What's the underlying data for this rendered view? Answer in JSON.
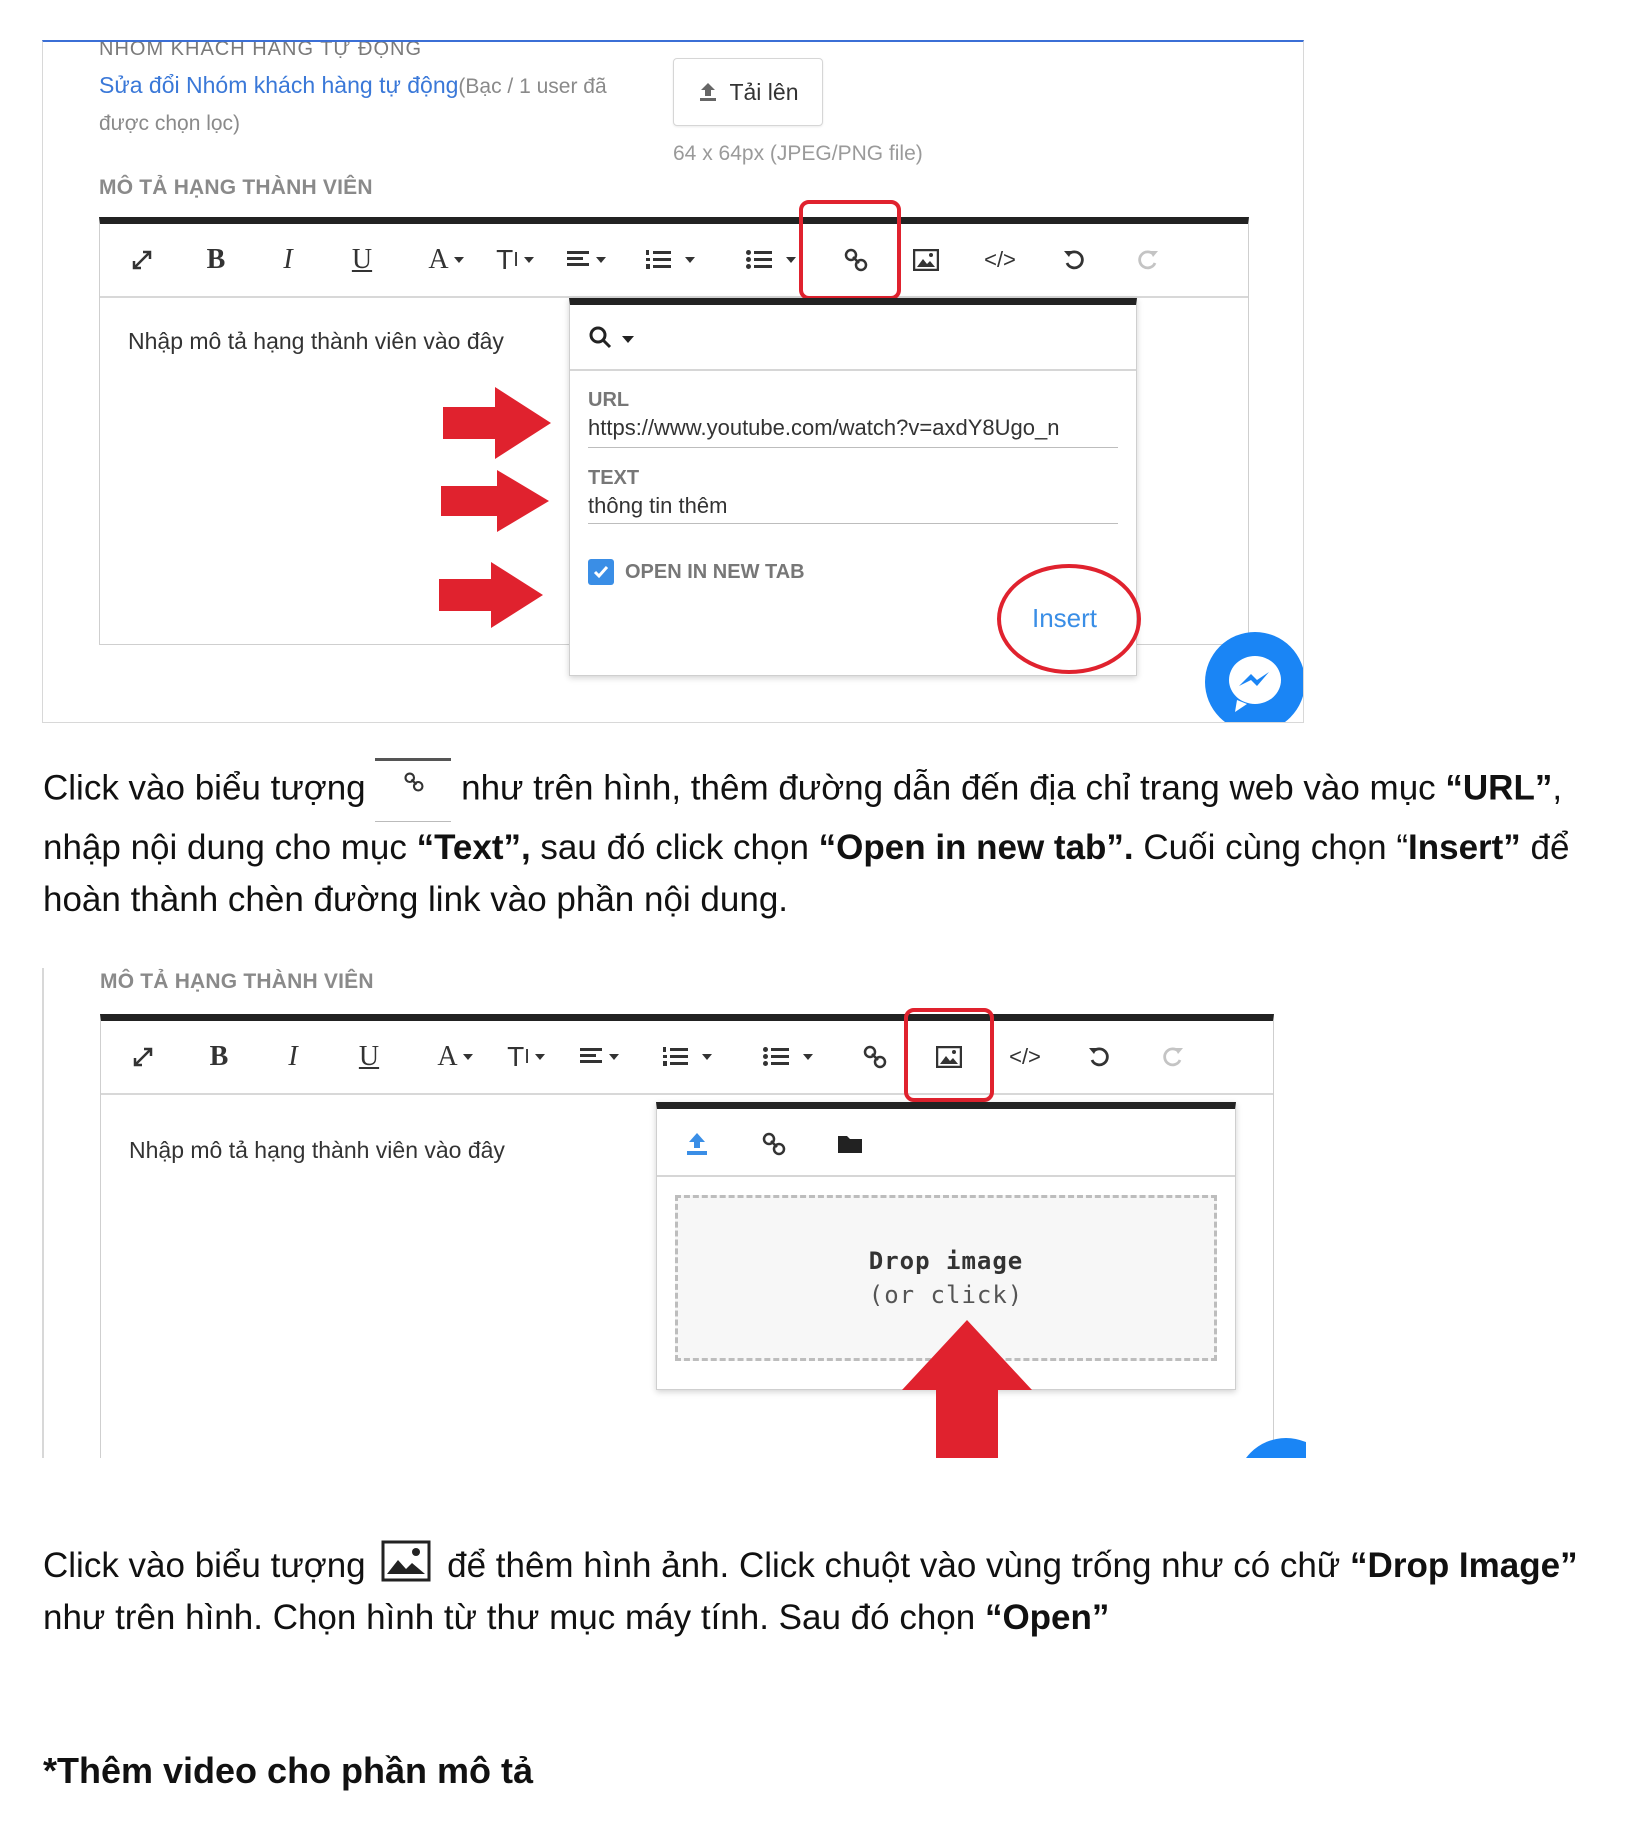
{
  "screenshot1": {
    "cutoff_heading": "NHÓM KHÁCH HÀNG TỰ ĐỘNG",
    "edit_link": "Sửa đổi Nhóm khách hàng tự động",
    "edit_meta_line1": "(Bạc / 1 user đã",
    "edit_meta_line2": "được chọn lọc)",
    "upload_button": "Tải lên",
    "upload_hint": "64 x 64px (JPEG/PNG file)",
    "section_label": "MÔ TẢ HẠNG THÀNH VIÊN",
    "editor_placeholder": "Nhập mô tả hạng thành viên vào đây",
    "link_popup": {
      "url_label": "URL",
      "url_value": "https://www.youtube.com/watch?v=axdY8Ugo_n",
      "text_label": "TEXT",
      "text_value": "thông tin thêm",
      "open_new_tab_label": "OPEN IN NEW TAB",
      "open_new_tab_checked": true,
      "insert_label": "Insert"
    }
  },
  "paragraph1": {
    "p1": "Click vào biểu tượng ",
    "p2": " như trên hình, thêm đường dẫn đến địa chỉ trang web vào mục ",
    "b1": "“URL”",
    "p3": ", nhập nội dung cho mục  ",
    "b2": "“Text”,",
    "p4": " sau đó click chọn ",
    "b3": "“Open in new tab”.",
    "p5": " Cuối cùng chọn “",
    "b4": "Insert”",
    "p6": "  để hoàn thành chèn đường link vào phần nội dung."
  },
  "screenshot2": {
    "section_label": "MÔ TẢ HẠNG THÀNH VIÊN",
    "editor_placeholder": "Nhập mô tả hạng thành viên vào đây",
    "image_popup": {
      "drop_title": "Drop image",
      "drop_subtitle": "(or click)"
    }
  },
  "paragraph2": {
    "p1": "Click vào biểu tượng ",
    "p2": " để thêm hình ảnh. Click chuột vào vùng trống như có chữ ",
    "b1": "“Drop Image”",
    "p3": " như trên hình. Chọn hình từ thư mục máy tính. Sau đó chọn ",
    "b2": "“Open”"
  },
  "heading": "*Thêm video cho phần mô tả",
  "colors": {
    "annotation_red": "#e0222e",
    "accent_blue": "#3a8ee6",
    "link_blue": "#3a78d8"
  }
}
